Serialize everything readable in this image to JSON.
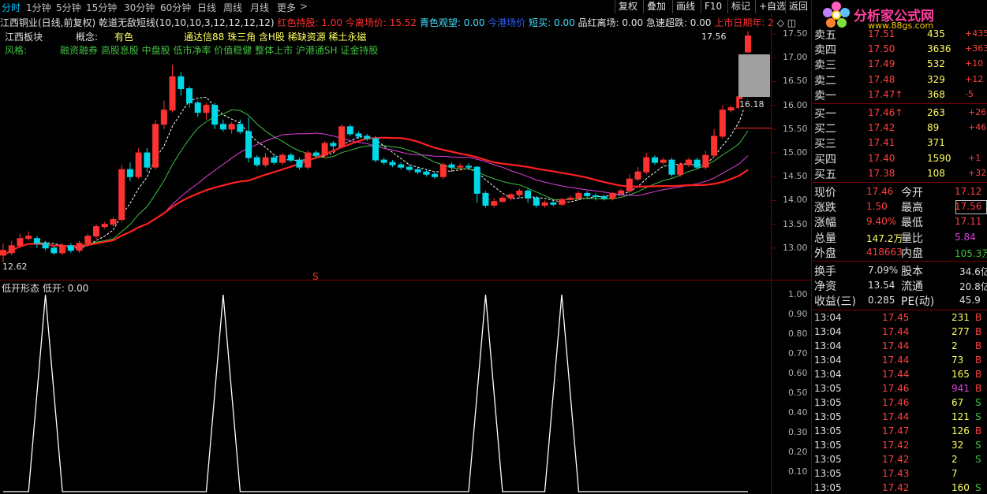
{
  "toolbar": {
    "periods": [
      "分时",
      "1分钟",
      "5分钟",
      "15分钟",
      "30分钟",
      "60分钟",
      "日线",
      "周线",
      "月线",
      "更多"
    ],
    "buttons": [
      "复权",
      "叠加",
      "画线",
      "F10",
      "标记",
      "+自选",
      "返回"
    ]
  },
  "header": {
    "stock": "江西铜业(日线,前复权)",
    "indicator": "乾道无敌短线(10,10,10,3,12,12,12,12)",
    "hold_label": "红色持股: 1.00",
    "leave_label": "今离场价: 15.52",
    "watch_label": "青色观望: 0.00",
    "hk_label": "今港场价",
    "short_label": "短买: 0.00",
    "exit_label": "品红离场: 0.00",
    "rise_label": "急速超跌: 0.00",
    "ipo_label": "上市日期年: 2"
  },
  "tags": {
    "board_label": "江西板块",
    "concept_label": "概念:",
    "concept_value": "有色",
    "concept_list": "通达信88 珠三角 含H股 稀缺资源 稀土永磁",
    "style_label": "风格:",
    "style_list": "融资融券 高股息股 中盘股 低市净率 价值稳健 整体上市 沪港通SH 证金持股"
  },
  "price_axis": {
    "ticks": [
      "17.50",
      "17.00",
      "16.50",
      "16.00",
      "15.50",
      "15.00",
      "14.50",
      "14.00",
      "13.50",
      "13.00"
    ],
    "high_marker": "17.56",
    "current_marker": "16.18",
    "low_marker": "12.62"
  },
  "sub_chart": {
    "title": "低开形态 低开: 0.00",
    "ticks": [
      "1.00",
      "0.90",
      "0.80",
      "0.70",
      "0.60",
      "0.50",
      "0.40",
      "0.30",
      "0.20",
      "0.10"
    ],
    "s_marker": "S"
  },
  "brand": {
    "logo_text": "分析家公式网",
    "site": "www.88gs.com"
  },
  "quote": {
    "sell_levels": [
      {
        "label": "卖五",
        "price": "17.51",
        "vol": "435",
        "chg": "+435"
      },
      {
        "label": "卖四",
        "price": "17.50",
        "vol": "3636",
        "chg": "+3636"
      },
      {
        "label": "卖三",
        "price": "17.49",
        "vol": "532",
        "chg": "+10"
      },
      {
        "label": "卖二",
        "price": "17.48",
        "vol": "329",
        "chg": "+12"
      },
      {
        "label": "卖一",
        "price": "17.47↑",
        "vol": "368",
        "chg": "-5"
      }
    ],
    "buy_levels": [
      {
        "label": "买一",
        "price": "17.46↑",
        "vol": "263",
        "chg": "+263"
      },
      {
        "label": "买二",
        "price": "17.42",
        "vol": "89",
        "chg": "+46"
      },
      {
        "label": "买三",
        "price": "17.41",
        "vol": "371",
        "chg": ""
      },
      {
        "label": "买四",
        "price": "17.40",
        "vol": "1590",
        "chg": "+1"
      },
      {
        "label": "买五",
        "price": "17.38",
        "vol": "108",
        "chg": "+32"
      }
    ],
    "stats": [
      {
        "l1": "现价",
        "v1": "17.46",
        "l2": "今开",
        "v2": "17.12"
      },
      {
        "l1": "涨跌",
        "v1": "1.50",
        "l2": "最高",
        "v2": "17.56"
      },
      {
        "l1": "涨幅",
        "v1": "9.40%",
        "l2": "最低",
        "v2": "17.11"
      },
      {
        "l1": "总量",
        "v1": "147.2万",
        "l2": "量比",
        "v2": "5.84"
      },
      {
        "l1": "外盘",
        "v1": "418663",
        "l2": "内盘",
        "v2": "105.3万"
      }
    ],
    "stats2": [
      {
        "l1": "换手",
        "v1": "7.09%",
        "l2": "股本",
        "v2": "34.6亿"
      },
      {
        "l1": "净资",
        "v1": "13.54",
        "l2": "流通",
        "v2": "20.8亿"
      },
      {
        "l1": "收益(三)",
        "v1": "0.285",
        "l2": "PE(动)",
        "v2": "45.9"
      }
    ],
    "trades": [
      {
        "t": "13:04",
        "p": "17.45",
        "v": "231",
        "s": "B"
      },
      {
        "t": "13:04",
        "p": "17.44",
        "v": "277",
        "s": "B"
      },
      {
        "t": "13:04",
        "p": "17.44",
        "v": "2",
        "s": "B"
      },
      {
        "t": "13:04",
        "p": "17.44",
        "v": "73",
        "s": "B"
      },
      {
        "t": "13:04",
        "p": "17.44",
        "v": "165",
        "s": "B"
      },
      {
        "t": "13:05",
        "p": "17.46",
        "v": "941",
        "s": "B"
      },
      {
        "t": "13:05",
        "p": "17.46",
        "v": "67",
        "s": "S"
      },
      {
        "t": "13:05",
        "p": "17.44",
        "v": "121",
        "s": "S"
      },
      {
        "t": "13:05",
        "p": "17.47",
        "v": "126",
        "s": "B"
      },
      {
        "t": "13:05",
        "p": "17.42",
        "v": "32",
        "s": "S"
      },
      {
        "t": "13:05",
        "p": "17.42",
        "v": "2",
        "s": "S"
      },
      {
        "t": "13:05",
        "p": "17.43",
        "v": "7",
        "s": ""
      },
      {
        "t": "13:05",
        "p": "17.42",
        "v": "160",
        "s": "S"
      }
    ]
  },
  "colors": {
    "up": "#ff3232",
    "down": "#00d8e8",
    "yellow": "#ffff00",
    "magenta": "#e040e0",
    "green": "#40c040"
  },
  "chart_data": {
    "type": "candlestick",
    "ylim": [
      12.5,
      17.75
    ],
    "candles": [
      [
        12.95,
        12.85,
        13.1,
        12.7,
        "up"
      ],
      [
        12.9,
        13.05,
        13.15,
        12.85,
        "up"
      ],
      [
        13.05,
        13.2,
        13.3,
        13.0,
        "up"
      ],
      [
        13.2,
        13.25,
        13.35,
        13.15,
        "up"
      ],
      [
        13.2,
        13.1,
        13.25,
        13.0,
        "down"
      ],
      [
        13.1,
        13.0,
        13.15,
        12.95,
        "down"
      ],
      [
        13.0,
        12.9,
        13.05,
        12.85,
        "down"
      ],
      [
        12.9,
        13.05,
        13.1,
        12.85,
        "up"
      ],
      [
        13.05,
        12.95,
        13.1,
        12.9,
        "down"
      ],
      [
        12.95,
        13.1,
        13.15,
        12.9,
        "up"
      ],
      [
        13.1,
        13.25,
        13.3,
        13.05,
        "up"
      ],
      [
        13.25,
        13.45,
        13.5,
        13.2,
        "up"
      ],
      [
        13.45,
        13.5,
        13.55,
        13.4,
        "up"
      ],
      [
        13.5,
        13.6,
        13.65,
        13.45,
        "up"
      ],
      [
        13.6,
        14.65,
        14.75,
        13.55,
        "up"
      ],
      [
        14.65,
        14.5,
        14.8,
        14.4,
        "down"
      ],
      [
        14.5,
        15.0,
        15.1,
        14.45,
        "up"
      ],
      [
        15.0,
        14.7,
        15.1,
        14.6,
        "down"
      ],
      [
        14.7,
        15.6,
        15.7,
        14.65,
        "up"
      ],
      [
        15.6,
        15.9,
        16.1,
        15.5,
        "up"
      ],
      [
        15.9,
        16.6,
        16.85,
        15.85,
        "up"
      ],
      [
        16.6,
        16.35,
        16.7,
        16.2,
        "down"
      ],
      [
        16.35,
        16.05,
        16.4,
        15.95,
        "down"
      ],
      [
        16.05,
        15.85,
        16.1,
        15.75,
        "down"
      ],
      [
        15.85,
        16.0,
        16.05,
        15.7,
        "up"
      ],
      [
        16.0,
        15.6,
        16.05,
        15.5,
        "down"
      ],
      [
        15.6,
        15.5,
        15.7,
        15.45,
        "down"
      ],
      [
        15.5,
        15.6,
        15.65,
        15.4,
        "up"
      ],
      [
        15.6,
        15.45,
        15.7,
        15.4,
        "down"
      ],
      [
        15.45,
        14.9,
        15.75,
        14.8,
        "down"
      ],
      [
        14.9,
        14.75,
        14.95,
        14.7,
        "down"
      ],
      [
        14.75,
        14.9,
        15.0,
        14.7,
        "up"
      ],
      [
        14.9,
        14.8,
        14.95,
        14.75,
        "down"
      ],
      [
        14.8,
        14.95,
        15.0,
        14.75,
        "up"
      ],
      [
        14.95,
        14.85,
        15.0,
        14.8,
        "down"
      ],
      [
        14.85,
        14.7,
        14.9,
        14.65,
        "down"
      ],
      [
        14.7,
        15.0,
        15.05,
        14.65,
        "up"
      ],
      [
        15.0,
        14.95,
        15.05,
        14.9,
        "down"
      ],
      [
        14.95,
        15.2,
        15.25,
        14.9,
        "up"
      ],
      [
        15.2,
        15.15,
        15.25,
        15.05,
        "down"
      ],
      [
        15.15,
        15.55,
        15.6,
        15.1,
        "up"
      ],
      [
        15.55,
        15.4,
        15.6,
        15.35,
        "down"
      ],
      [
        15.4,
        15.35,
        15.45,
        15.3,
        "down"
      ],
      [
        15.35,
        15.3,
        15.4,
        15.25,
        "down"
      ],
      [
        15.3,
        14.85,
        15.35,
        14.8,
        "down"
      ],
      [
        14.85,
        14.8,
        14.9,
        14.75,
        "down"
      ],
      [
        14.8,
        14.75,
        14.85,
        14.7,
        "down"
      ],
      [
        14.75,
        14.7,
        14.8,
        14.65,
        "down"
      ],
      [
        14.7,
        14.65,
        14.75,
        14.6,
        "down"
      ],
      [
        14.65,
        14.6,
        14.7,
        14.55,
        "down"
      ],
      [
        14.6,
        14.55,
        14.65,
        14.5,
        "down"
      ],
      [
        14.55,
        14.5,
        14.6,
        14.45,
        "down"
      ],
      [
        14.5,
        14.75,
        14.8,
        14.45,
        "up"
      ],
      [
        14.75,
        14.7,
        14.8,
        14.6,
        "down"
      ],
      [
        14.7,
        14.72,
        14.78,
        14.62,
        "up"
      ],
      [
        14.72,
        14.7,
        14.78,
        14.65,
        "down"
      ],
      [
        14.7,
        14.15,
        14.72,
        13.95,
        "down"
      ],
      [
        14.15,
        13.9,
        14.2,
        13.85,
        "down"
      ],
      [
        13.9,
        13.98,
        14.05,
        13.85,
        "up"
      ],
      [
        13.98,
        14.05,
        14.1,
        13.95,
        "up"
      ],
      [
        14.05,
        14.12,
        14.15,
        14.0,
        "up"
      ],
      [
        14.12,
        14.2,
        14.25,
        14.05,
        "up"
      ],
      [
        14.2,
        14.05,
        14.25,
        13.95,
        "down"
      ],
      [
        14.05,
        13.9,
        14.1,
        13.85,
        "down"
      ],
      [
        13.9,
        13.95,
        14.0,
        13.85,
        "up"
      ],
      [
        13.95,
        13.92,
        14.0,
        13.88,
        "down"
      ],
      [
        13.92,
        14.02,
        14.05,
        13.88,
        "up"
      ],
      [
        14.02,
        14.05,
        14.1,
        14.0,
        "up"
      ],
      [
        14.05,
        14.15,
        14.2,
        14.0,
        "up"
      ],
      [
        14.15,
        14.1,
        14.2,
        14.05,
        "down"
      ],
      [
        14.1,
        14.08,
        14.15,
        14.0,
        "down"
      ],
      [
        14.08,
        14.05,
        14.12,
        14.0,
        "down"
      ],
      [
        14.05,
        14.15,
        14.18,
        14.0,
        "up"
      ],
      [
        14.15,
        14.2,
        14.25,
        14.1,
        "up"
      ],
      [
        14.2,
        14.45,
        14.55,
        14.15,
        "up"
      ],
      [
        14.45,
        14.6,
        14.7,
        14.4,
        "up"
      ],
      [
        14.6,
        14.9,
        15.0,
        14.55,
        "up"
      ],
      [
        14.9,
        14.8,
        14.95,
        14.75,
        "down"
      ],
      [
        14.8,
        14.85,
        14.9,
        14.75,
        "up"
      ],
      [
        14.85,
        14.55,
        14.9,
        14.5,
        "down"
      ],
      [
        14.55,
        14.75,
        14.8,
        14.5,
        "up"
      ],
      [
        14.75,
        14.85,
        14.9,
        14.7,
        "up"
      ],
      [
        14.85,
        14.7,
        14.9,
        14.65,
        "down"
      ],
      [
        14.7,
        14.95,
        15.05,
        14.65,
        "up"
      ],
      [
        14.95,
        15.35,
        15.5,
        14.9,
        "up"
      ],
      [
        15.35,
        15.9,
        16.0,
        15.3,
        "up"
      ],
      [
        15.9,
        15.95,
        16.0,
        15.85,
        "up"
      ],
      [
        15.95,
        16.18,
        16.25,
        15.9,
        "up"
      ],
      [
        17.12,
        17.46,
        17.56,
        17.11,
        "up"
      ]
    ]
  },
  "sub_chart_data": {
    "type": "line",
    "ylim": [
      0,
      1
    ],
    "spikes_at": [
      5,
      26,
      57,
      66
    ]
  }
}
